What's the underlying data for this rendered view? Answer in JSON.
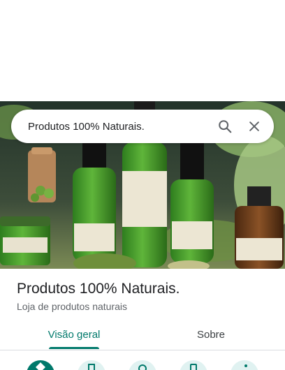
{
  "search": {
    "query": "Produtos 100% Naturais."
  },
  "icons": {
    "search": "search-icon",
    "close": "close-icon"
  },
  "place": {
    "name": "Produtos 100% Naturais.",
    "category": "Loja de produtos naturais"
  },
  "tabs": [
    {
      "label": "Visão geral",
      "active": true
    },
    {
      "label": "Sobre",
      "active": false
    }
  ],
  "action_buttons": [
    "directions-icon",
    "save-icon",
    "nearby-icon",
    "send-to-phone-icon",
    "share-icon"
  ],
  "colors": {
    "accent": "#00796b",
    "accent_light": "#e0f2f1",
    "text_primary": "#202124",
    "text_secondary": "#5f6368"
  }
}
